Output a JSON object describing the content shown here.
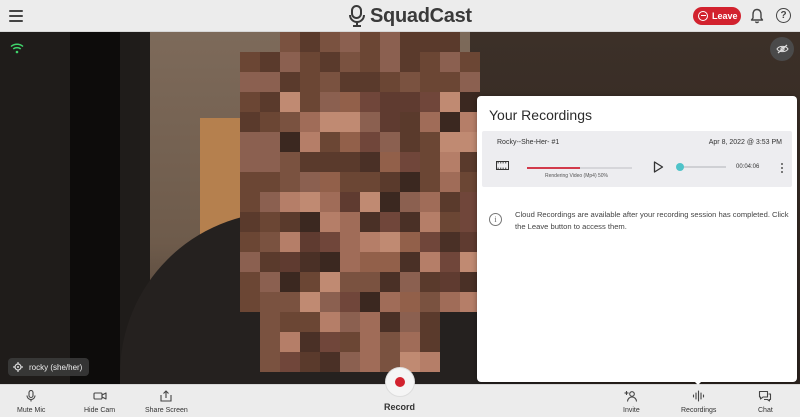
{
  "app": {
    "logo_text": "SquadCast",
    "leave_label": "Leave",
    "help_label": "?"
  },
  "participant": {
    "name": "rocky (she/her)"
  },
  "recordings_panel": {
    "title": "Your Recordings",
    "recording": {
      "name": "Rocky--She-Her- #1",
      "date": "Apr 8, 2022 @ 3:53 PM",
      "render_status": "Rendering Video (Mp4) 50%",
      "render_progress": 0.5,
      "duration": "00:04:06"
    },
    "info_text": "Cloud Recordings are available after your recording session has completed. Click the Leave button to access them."
  },
  "bottom_controls": {
    "mute_mic": "Mute Mic",
    "hide_cam": "Hide Cam",
    "share_screen": "Share Screen",
    "record": "Record",
    "invite": "Invite",
    "recordings": "Recordings",
    "chat": "Chat"
  },
  "colors": {
    "leave_red": "#d2222e",
    "record_red": "#d2222e",
    "seek_teal": "#4fc3c9",
    "render_pink": "#d23a4b"
  },
  "icons": [
    "menu-icon",
    "squadcast-mic-logo-icon",
    "leave-icon",
    "bell-icon",
    "help-icon",
    "wifi-signal-icon",
    "eye-off-icon",
    "gear-icon",
    "film-icon",
    "play-icon",
    "more-vertical-icon",
    "info-icon",
    "microphone-icon",
    "camera-icon",
    "share-screen-icon",
    "add-user-icon",
    "soundwave-icon",
    "chat-icon"
  ]
}
